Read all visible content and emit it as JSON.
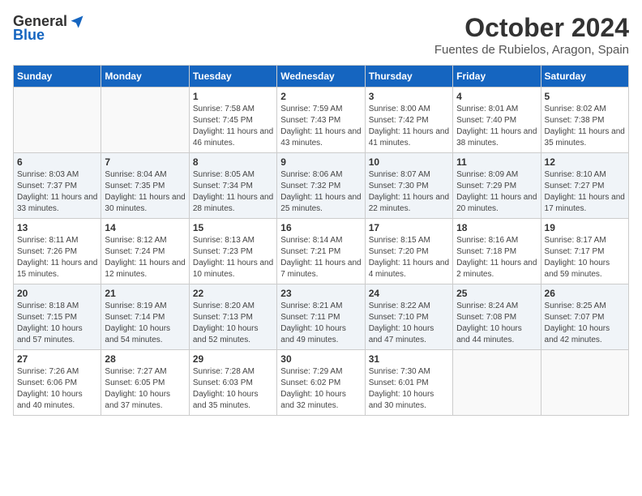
{
  "logo": {
    "general": "General",
    "blue": "Blue"
  },
  "header": {
    "month": "October 2024",
    "location": "Fuentes de Rubielos, Aragon, Spain"
  },
  "weekdays": [
    "Sunday",
    "Monday",
    "Tuesday",
    "Wednesday",
    "Thursday",
    "Friday",
    "Saturday"
  ],
  "weeks": [
    [
      {
        "day": "",
        "info": ""
      },
      {
        "day": "",
        "info": ""
      },
      {
        "day": "1",
        "info": "Sunrise: 7:58 AM\nSunset: 7:45 PM\nDaylight: 11 hours and 46 minutes."
      },
      {
        "day": "2",
        "info": "Sunrise: 7:59 AM\nSunset: 7:43 PM\nDaylight: 11 hours and 43 minutes."
      },
      {
        "day": "3",
        "info": "Sunrise: 8:00 AM\nSunset: 7:42 PM\nDaylight: 11 hours and 41 minutes."
      },
      {
        "day": "4",
        "info": "Sunrise: 8:01 AM\nSunset: 7:40 PM\nDaylight: 11 hours and 38 minutes."
      },
      {
        "day": "5",
        "info": "Sunrise: 8:02 AM\nSunset: 7:38 PM\nDaylight: 11 hours and 35 minutes."
      }
    ],
    [
      {
        "day": "6",
        "info": "Sunrise: 8:03 AM\nSunset: 7:37 PM\nDaylight: 11 hours and 33 minutes."
      },
      {
        "day": "7",
        "info": "Sunrise: 8:04 AM\nSunset: 7:35 PM\nDaylight: 11 hours and 30 minutes."
      },
      {
        "day": "8",
        "info": "Sunrise: 8:05 AM\nSunset: 7:34 PM\nDaylight: 11 hours and 28 minutes."
      },
      {
        "day": "9",
        "info": "Sunrise: 8:06 AM\nSunset: 7:32 PM\nDaylight: 11 hours and 25 minutes."
      },
      {
        "day": "10",
        "info": "Sunrise: 8:07 AM\nSunset: 7:30 PM\nDaylight: 11 hours and 22 minutes."
      },
      {
        "day": "11",
        "info": "Sunrise: 8:09 AM\nSunset: 7:29 PM\nDaylight: 11 hours and 20 minutes."
      },
      {
        "day": "12",
        "info": "Sunrise: 8:10 AM\nSunset: 7:27 PM\nDaylight: 11 hours and 17 minutes."
      }
    ],
    [
      {
        "day": "13",
        "info": "Sunrise: 8:11 AM\nSunset: 7:26 PM\nDaylight: 11 hours and 15 minutes."
      },
      {
        "day": "14",
        "info": "Sunrise: 8:12 AM\nSunset: 7:24 PM\nDaylight: 11 hours and 12 minutes."
      },
      {
        "day": "15",
        "info": "Sunrise: 8:13 AM\nSunset: 7:23 PM\nDaylight: 11 hours and 10 minutes."
      },
      {
        "day": "16",
        "info": "Sunrise: 8:14 AM\nSunset: 7:21 PM\nDaylight: 11 hours and 7 minutes."
      },
      {
        "day": "17",
        "info": "Sunrise: 8:15 AM\nSunset: 7:20 PM\nDaylight: 11 hours and 4 minutes."
      },
      {
        "day": "18",
        "info": "Sunrise: 8:16 AM\nSunset: 7:18 PM\nDaylight: 11 hours and 2 minutes."
      },
      {
        "day": "19",
        "info": "Sunrise: 8:17 AM\nSunset: 7:17 PM\nDaylight: 10 hours and 59 minutes."
      }
    ],
    [
      {
        "day": "20",
        "info": "Sunrise: 8:18 AM\nSunset: 7:15 PM\nDaylight: 10 hours and 57 minutes."
      },
      {
        "day": "21",
        "info": "Sunrise: 8:19 AM\nSunset: 7:14 PM\nDaylight: 10 hours and 54 minutes."
      },
      {
        "day": "22",
        "info": "Sunrise: 8:20 AM\nSunset: 7:13 PM\nDaylight: 10 hours and 52 minutes."
      },
      {
        "day": "23",
        "info": "Sunrise: 8:21 AM\nSunset: 7:11 PM\nDaylight: 10 hours and 49 minutes."
      },
      {
        "day": "24",
        "info": "Sunrise: 8:22 AM\nSunset: 7:10 PM\nDaylight: 10 hours and 47 minutes."
      },
      {
        "day": "25",
        "info": "Sunrise: 8:24 AM\nSunset: 7:08 PM\nDaylight: 10 hours and 44 minutes."
      },
      {
        "day": "26",
        "info": "Sunrise: 8:25 AM\nSunset: 7:07 PM\nDaylight: 10 hours and 42 minutes."
      }
    ],
    [
      {
        "day": "27",
        "info": "Sunrise: 7:26 AM\nSunset: 6:06 PM\nDaylight: 10 hours and 40 minutes."
      },
      {
        "day": "28",
        "info": "Sunrise: 7:27 AM\nSunset: 6:05 PM\nDaylight: 10 hours and 37 minutes."
      },
      {
        "day": "29",
        "info": "Sunrise: 7:28 AM\nSunset: 6:03 PM\nDaylight: 10 hours and 35 minutes."
      },
      {
        "day": "30",
        "info": "Sunrise: 7:29 AM\nSunset: 6:02 PM\nDaylight: 10 hours and 32 minutes."
      },
      {
        "day": "31",
        "info": "Sunrise: 7:30 AM\nSunset: 6:01 PM\nDaylight: 10 hours and 30 minutes."
      },
      {
        "day": "",
        "info": ""
      },
      {
        "day": "",
        "info": ""
      }
    ]
  ]
}
